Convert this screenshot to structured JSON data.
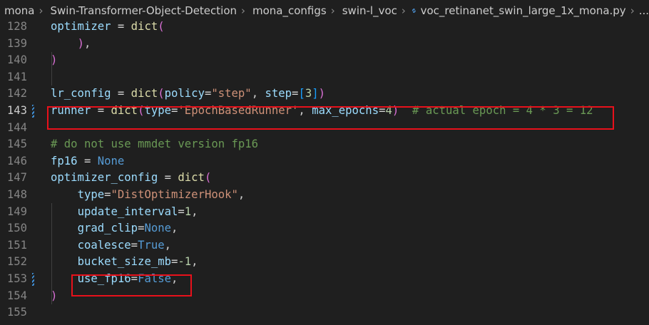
{
  "breadcrumb": {
    "items": [
      "mona",
      "Swin-Transformer-Object-Detection",
      "mona_configs",
      "swin-l_voc"
    ],
    "file": "voc_retinanet_swin_large_1x_mona.py",
    "more": "..."
  },
  "lines": [
    {
      "num": "128",
      "tokens": [
        {
          "t": "optimizer",
          "c": "var"
        },
        {
          "t": " = ",
          "c": "op"
        },
        {
          "t": "dict",
          "c": "fn"
        },
        {
          "t": "(",
          "c": "b1"
        }
      ]
    },
    {
      "num": "139",
      "tokens": [
        {
          "t": "    ",
          "c": "pl"
        },
        {
          "t": ")",
          "c": "b1"
        },
        {
          "t": ",",
          "c": "pl"
        }
      ]
    },
    {
      "num": "140",
      "tokens": [
        {
          "t": ")",
          "c": "b1"
        }
      ]
    },
    {
      "num": "141",
      "tokens": []
    },
    {
      "num": "142",
      "tokens": [
        {
          "t": "lr_config",
          "c": "var"
        },
        {
          "t": " = ",
          "c": "op"
        },
        {
          "t": "dict",
          "c": "fn"
        },
        {
          "t": "(",
          "c": "b1"
        },
        {
          "t": "policy",
          "c": "var"
        },
        {
          "t": "=",
          "c": "op"
        },
        {
          "t": "\"step\"",
          "c": "str"
        },
        {
          "t": ", ",
          "c": "pl"
        },
        {
          "t": "step",
          "c": "var"
        },
        {
          "t": "=",
          "c": "op"
        },
        {
          "t": "[",
          "c": "b2"
        },
        {
          "t": "3",
          "c": "num"
        },
        {
          "t": "]",
          "c": "b2"
        },
        {
          "t": ")",
          "c": "b1"
        }
      ]
    },
    {
      "num": "143",
      "active": true,
      "tokens": [
        {
          "t": "runner",
          "c": "var"
        },
        {
          "t": " = ",
          "c": "op"
        },
        {
          "t": "dict",
          "c": "fn"
        },
        {
          "t": "(",
          "c": "b1"
        },
        {
          "t": "type",
          "c": "var"
        },
        {
          "t": "=",
          "c": "op"
        },
        {
          "t": "'EpochBasedRunner'",
          "c": "str"
        },
        {
          "t": ", ",
          "c": "pl"
        },
        {
          "t": "max_epochs",
          "c": "var"
        },
        {
          "t": "=",
          "c": "op"
        },
        {
          "t": "4",
          "c": "num"
        },
        {
          "t": ")",
          "c": "b1"
        },
        {
          "t": "  # actual epoch = 4 * 3 = 12",
          "c": "com"
        }
      ]
    },
    {
      "num": "144",
      "tokens": []
    },
    {
      "num": "145",
      "tokens": [
        {
          "t": "# do not use mmdet version fp16",
          "c": "com"
        }
      ]
    },
    {
      "num": "146",
      "tokens": [
        {
          "t": "fp16",
          "c": "var"
        },
        {
          "t": " = ",
          "c": "op"
        },
        {
          "t": "None",
          "c": "kw"
        }
      ]
    },
    {
      "num": "147",
      "tokens": [
        {
          "t": "optimizer_config",
          "c": "var"
        },
        {
          "t": " = ",
          "c": "op"
        },
        {
          "t": "dict",
          "c": "fn"
        },
        {
          "t": "(",
          "c": "b1"
        }
      ]
    },
    {
      "num": "148",
      "tokens": [
        {
          "t": "    ",
          "c": "pl"
        },
        {
          "t": "type",
          "c": "var"
        },
        {
          "t": "=",
          "c": "op"
        },
        {
          "t": "\"DistOptimizerHook\"",
          "c": "str"
        },
        {
          "t": ",",
          "c": "pl"
        }
      ]
    },
    {
      "num": "149",
      "tokens": [
        {
          "t": "    ",
          "c": "pl"
        },
        {
          "t": "update_interval",
          "c": "var"
        },
        {
          "t": "=",
          "c": "op"
        },
        {
          "t": "1",
          "c": "num"
        },
        {
          "t": ",",
          "c": "pl"
        }
      ]
    },
    {
      "num": "150",
      "tokens": [
        {
          "t": "    ",
          "c": "pl"
        },
        {
          "t": "grad_clip",
          "c": "var"
        },
        {
          "t": "=",
          "c": "op"
        },
        {
          "t": "None",
          "c": "kw"
        },
        {
          "t": ",",
          "c": "pl"
        }
      ]
    },
    {
      "num": "151",
      "tokens": [
        {
          "t": "    ",
          "c": "pl"
        },
        {
          "t": "coalesce",
          "c": "var"
        },
        {
          "t": "=",
          "c": "op"
        },
        {
          "t": "True",
          "c": "kw"
        },
        {
          "t": ",",
          "c": "pl"
        }
      ]
    },
    {
      "num": "152",
      "tokens": [
        {
          "t": "    ",
          "c": "pl"
        },
        {
          "t": "bucket_size_mb",
          "c": "var"
        },
        {
          "t": "=",
          "c": "op"
        },
        {
          "t": "-1",
          "c": "num"
        },
        {
          "t": ",",
          "c": "pl"
        }
      ]
    },
    {
      "num": "153",
      "tokens": [
        {
          "t": "    ",
          "c": "pl"
        },
        {
          "t": "use_fp16",
          "c": "var"
        },
        {
          "t": "=",
          "c": "op"
        },
        {
          "t": "False",
          "c": "kw"
        },
        {
          "t": ",",
          "c": "pl"
        }
      ]
    },
    {
      "num": "154",
      "tokens": [
        {
          "t": ")",
          "c": "b1"
        }
      ]
    },
    {
      "num": "155",
      "tokens": []
    }
  ],
  "modified_lines": [
    "143",
    "153"
  ],
  "colors": {
    "background": "#1f1f1f",
    "variable": "#9cdcfe",
    "function": "#dcdcaa",
    "string": "#ce9178",
    "number": "#b5cea8",
    "comment": "#6a9955",
    "keyword": "#569cd6",
    "bracket_level1": "#da70d6",
    "bracket_level2": "#179fff",
    "highlight_box": "#e8111b"
  },
  "icons": {
    "file_type": "python-file-icon",
    "separator": "chevron-right-icon"
  }
}
